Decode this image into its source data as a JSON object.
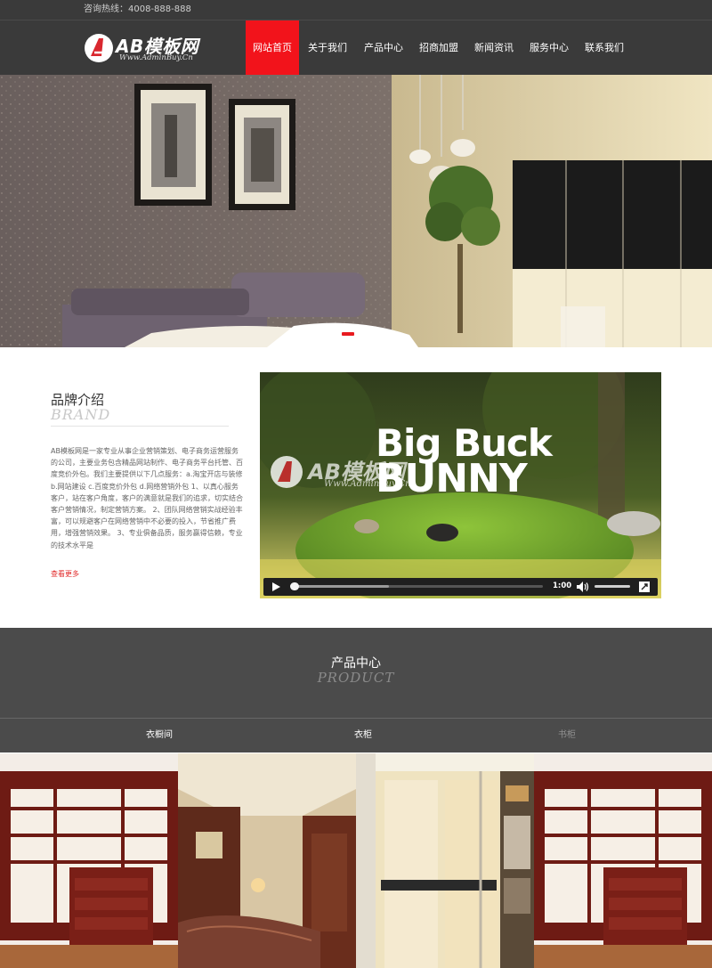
{
  "topbar": {
    "hotline": "咨询热线：4008-888-888"
  },
  "logo": {
    "name": "AB模板网",
    "url": "Www.AdminBuy.Cn"
  },
  "nav": {
    "items": [
      {
        "label": "网站首页",
        "active": true
      },
      {
        "label": "关于我们",
        "active": false
      },
      {
        "label": "产品中心",
        "active": false
      },
      {
        "label": "招商加盟",
        "active": false
      },
      {
        "label": "新闻资讯",
        "active": false
      },
      {
        "label": "服务中心",
        "active": false
      },
      {
        "label": "联系我们",
        "active": false
      }
    ]
  },
  "brand": {
    "title": "品牌介绍",
    "subtitle": "BRAND",
    "description": "AB模板网是一家专业从事企业营销策划、电子商务运营服务的公司，主要业务包含精品网站制作、电子商务平台托管、百度竞价外包。我们主要提供以下几点服务：a.淘宝开店与装修 b.网站建设 c.百度竞价外包 d.网络营销外包 1、以真心服务客户，站在客户角度，客户的满意就是我们的追求，切实结合客户营销情况，制定营销方案。 2、团队网络营销实战经验丰富，可以规避客户在网络营销中不必要的投入，节省推广费用，增强营销效果。 3、专业俱备品质，服务赢得信赖，专业的技术水平是",
    "more": "查看更多"
  },
  "video": {
    "poster_title_line1": "Big Buck",
    "poster_title_line2": "BUNNY",
    "watermark_name": "AB模板网",
    "watermark_url": "Www.AdminBuy.Cn",
    "time": "1:00",
    "progress": 0.39
  },
  "products": {
    "title": "产品中心",
    "subtitle": "PRODUCT",
    "tabs": [
      {
        "label": "衣橱间",
        "active": true
      },
      {
        "label": "衣柜",
        "active": true
      },
      {
        "label": "书柜",
        "active": false
      }
    ],
    "tab_colors": {
      "active": "#ffffff",
      "inactive": "#8f8f8f"
    }
  }
}
